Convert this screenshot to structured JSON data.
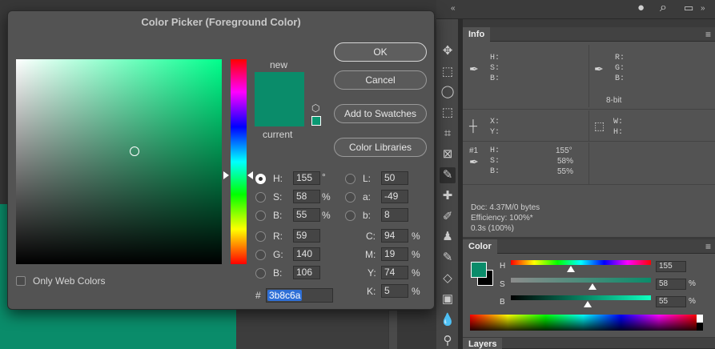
{
  "dialog": {
    "title": "Color Picker (Foreground Color)",
    "new_label": "new",
    "current_label": "current",
    "buttons": {
      "ok": "OK",
      "cancel": "Cancel",
      "add_to_swatches": "Add to Swatches",
      "color_libraries": "Color Libraries"
    },
    "only_web_colors": "Only Web Colors",
    "hsb": {
      "h": {
        "label": "H:",
        "value": "155",
        "unit": "°"
      },
      "s": {
        "label": "S:",
        "value": "58",
        "unit": "%"
      },
      "b": {
        "label": "B:",
        "value": "55",
        "unit": "%"
      }
    },
    "rgb": {
      "r": {
        "label": "R:",
        "value": "59"
      },
      "g": {
        "label": "G:",
        "value": "140"
      },
      "b": {
        "label": "B:",
        "value": "106"
      }
    },
    "lab": {
      "l": {
        "label": "L:",
        "value": "50"
      },
      "a": {
        "label": "a:",
        "value": "-49"
      },
      "b": {
        "label": "b:",
        "value": "8"
      }
    },
    "cmyk": {
      "c": {
        "label": "C:",
        "value": "94",
        "unit": "%"
      },
      "m": {
        "label": "M:",
        "value": "19",
        "unit": "%"
      },
      "y": {
        "label": "Y:",
        "value": "74",
        "unit": "%"
      },
      "k": {
        "label": "K:",
        "value": "5",
        "unit": "%"
      }
    },
    "hex": {
      "label": "#",
      "value": "3b8c6a"
    },
    "selected_mode": "H",
    "colors": {
      "swatch": "#0a8c6a",
      "web_safe_preview": "#0a9973"
    }
  },
  "info_panel": {
    "tab": "Info",
    "hsb_block": "H:\nS:\nB:",
    "rgb_block": "R:\nG:\nB:",
    "bit_depth": "8-bit",
    "xy_block": "X:\nY:",
    "wh_block": "W:\nH:",
    "sample_label": "#1",
    "sample_block": "H:\nS:\nB:",
    "sample_values": {
      "h": "155°",
      "s": "58%",
      "b": "55%"
    },
    "doc": "Doc: 4.37M/0 bytes",
    "efficiency": "Efficiency: 100%*",
    "timing": "0.3s (100%)"
  },
  "color_panel": {
    "tab": "Color",
    "h": {
      "label": "H",
      "value": "155"
    },
    "s": {
      "label": "S",
      "value": "58",
      "unit": "%"
    },
    "b": {
      "label": "B",
      "value": "55",
      "unit": "%"
    },
    "slider_levels": {
      "h": 0.43,
      "s": 0.58,
      "b": 0.55
    },
    "foreground": "#0a8c6a",
    "background": "#000000"
  },
  "layers_panel": {
    "tab": "Layers"
  },
  "tools": [
    "move-icon",
    "marquee-icon",
    "lasso-icon",
    "quick-select-icon",
    "crop-icon",
    "frame-icon",
    "eyedropper-icon",
    "healing-icon",
    "brush-icon",
    "stamp-icon",
    "history-brush-icon",
    "eraser-icon",
    "gradient-icon",
    "blur-icon",
    "dodge-icon"
  ],
  "topbar_icons": [
    "user-icon",
    "search-icon",
    "workspace-icon"
  ]
}
